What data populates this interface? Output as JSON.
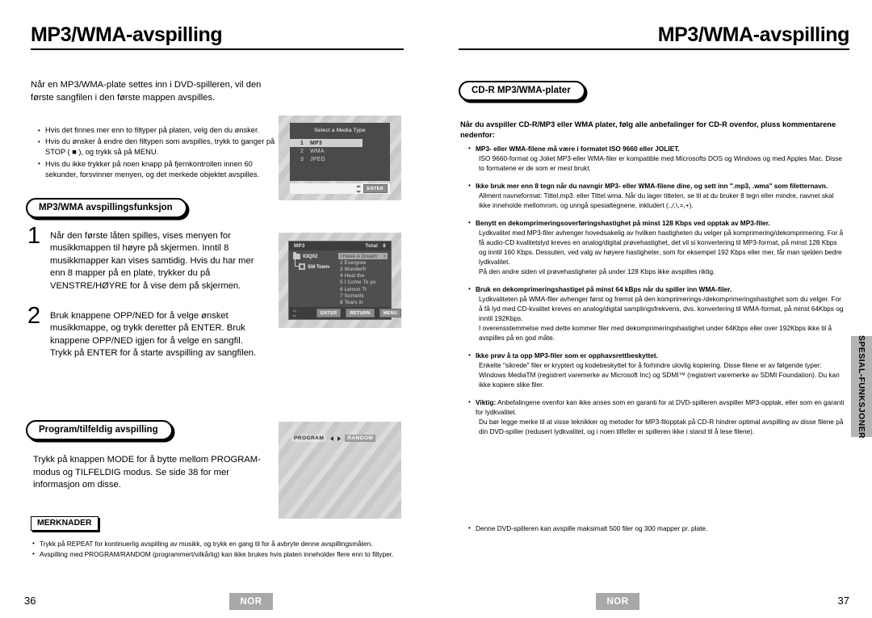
{
  "left_page": {
    "title": "MP3/WMA-avspilling",
    "intro": "Når en MP3/WMA-plate settes inn i DVD-spilleren, vil den første sangfilen i den første mappen avspilles.",
    "intro_bullets": [
      "Hvis det finnes mer enn to filtyper på platen, velg den du ønsker.",
      "Hvis du ønsker å endre den filtypen som avspilles, trykk to ganger på STOP ( ■ ), og trykk så på MENU.",
      "Hvis du ikke trykker på noen knapp på fjernkontrollen innen 60 sekunder, forsvinner menyen, og det merkede objektet avspilles."
    ],
    "section1_heading": "MP3/WMA avspillingsfunksjon",
    "steps": [
      {
        "num": "1",
        "text": "Når den første låten spilles, vises menyen for musikkmappen til høyre på skjermen. Inntil 8 musikkmapper kan vises samtidig. Hvis du har mer enn 8 mapper på en plate, trykker du på VENSTRE/HØYRE for å vise dem på skjermen."
      },
      {
        "num": "2",
        "text": "Bruk knappene OPP/NED for å velge ønsket musikkmappe, og trykk deretter på ENTER. Bruk knappene OPP/NED igjen for å velge en sangfil. Trykk på ENTER for å starte avspilling av sangfilen."
      }
    ],
    "section2_heading": "Program/tilfeldig avspilling",
    "section2_text": "Trykk på knappen MODE for å bytte mellom PROGRAM-modus og TILFELDIG modus. Se side 38 for mer informasjon om disse.",
    "notes_tag": "MERKNADER",
    "notes": [
      "Trykk på REPEAT for kontinuerlig avspilling av musikk, og trykk en gang til for å avbryte denne avspillingsmåten.",
      "Avspilling med PROGRAM/RANDOM (programmert/vilkårlig) kan ikke brukes hvis platen inneholder flere enn to filtyper."
    ],
    "page_number": "36",
    "language_badge": "NOR"
  },
  "osd_media_type": {
    "caption": "Select a Media Type",
    "options": [
      {
        "index": "1",
        "label": "MP3",
        "selected": true
      },
      {
        "index": "2",
        "label": "WMA",
        "selected": false
      },
      {
        "index": "3",
        "label": "JPEG",
        "selected": false
      }
    ],
    "enter_button": "ENTER"
  },
  "osd_mp3_browser": {
    "mode_label": "MP3",
    "total_label": "Total",
    "total_value": "8",
    "folder": "03Q02",
    "file": "SM Town-",
    "tracks": [
      {
        "index": "1",
        "title": "I Have A Dream",
        "selected": true
      },
      {
        "index": "2",
        "title": "Evergree",
        "selected": false
      },
      {
        "index": "3",
        "title": "Wonderfr",
        "selected": false
      },
      {
        "index": "4",
        "title": "Heal the",
        "selected": false
      },
      {
        "index": "5",
        "title": "I Come To yo",
        "selected": false
      },
      {
        "index": "6",
        "title": "Lemon Tr",
        "selected": false
      },
      {
        "index": "7",
        "title": "Somethi",
        "selected": false
      },
      {
        "index": "8",
        "title": "Tears in",
        "selected": false
      }
    ],
    "buttons": [
      "ENTER",
      "RETURN",
      "MENU"
    ]
  },
  "osd_program_random": {
    "program_label": "PROGRAM",
    "random_label": "RANDOM"
  },
  "right_page": {
    "title": "MP3/WMA-avspilling",
    "heading": "CD-R MP3/WMA-plater",
    "intro": "Når du avspiller CD-R/MP3 eller WMA plater, følg alle anbefalinger for CD-R ovenfor, pluss kommentarene nedenfor:",
    "items": [
      {
        "bold": "MP3- eller WMA-filene må være i formatet ISO 9660 eller JOLIET.",
        "body": "ISO 9660-format og Joliet MP3-eller WMA-filer er kompatible med Microsofts DOS og Windows og med Apples Mac. Disse to formatene er de som er mest brukt."
      },
      {
        "bold": "Ikke bruk mer enn 8 tegn når du navngir MP3- eller WMA-filene dine, og sett inn \".mp3, .wma\" som filetternavn.",
        "body": "Allment navneformat: Tittel.mp3. eller Tittel.wma. Når du lager tittelen, se til at du bruker 8 tegn eller mindre, navnet skal ikke inneholde mellomrom, og unngå spesialtegnene, inkludert (.,/,\\,=,+)."
      },
      {
        "bold": "Benytt en dekomprimeringsoverføringshastighet på minst 128 Kbps ved opptak av MP3-filer.",
        "body": "Lydkvalitet med MP3-filer avhenger hovedsakelig av hvilken hastigheten du velger på komprimering/dekomprimering. For å få audio-CD kvalitetslyd kreves en analog/digital prøvehastighet, det vil si konvertering til MP3-format, på minst 128 Kbps og inntil 160 Kbps. Dessuten, ved valg av høyere hastigheter, som for eksempel 192 Kbps eller mer, får man sjelden bedre lydkvalitet.",
        "body2": "På den andre siden vil prøvehastigheter på under 128 Kbps ikke avspilles riktig."
      },
      {
        "bold": "Bruk en dekomprimeringshastiget på minst 64 kBps når du spiller inn WMA-filer.",
        "body": "Lydkvaliteten på WMA-filer avhenger først og fremst på den komprimerings-/dekomprimeringshastighet som du velger. For å få lyd med CD-kvalitet kreves en analog/digital samplingsfrekvens, dvs. konvertering til WMA-format, på minst 64Kbps og inntil 192Kbps.",
        "body2": "I overensstemmelse med dette kommer filer med dekomprimeringshastighet under 64Kbps eller over 192Kbps ikke til å avspilles på en god måte."
      },
      {
        "bold": "Ikke prøv å ta opp MP3-filer som er opphavsrettbeskyttet.",
        "body": "Enkelte \"sikrede\" filer er kryptert og kodebeskyttet for å forhindre ulovlig kopiering. Disse filene er av følgende typer: Windows MediaTM (registrert varemerke av Microsoft Inc) og SDMI™ (registrert varemerke av SDMI Foundation). Du kan ikke kopiere slike filer."
      },
      {
        "bold": "Viktig:",
        "bold_inline_rest": " Anbefalingene ovenfor kan ikke anses som en garanti for at DVD-spilleren avspiller MP3-opptak, eller som en garanti for lydkvalitet.",
        "body": "Du bør legge merke til at visse teknikker og metoder for MP3-filopptak på CD-R hindrer optimal avspilling av disse filene på din DVD-spiller (redusert lydkvalitet, og i noen tilfeller er spilleren ikke i stand til å lese filene)."
      }
    ],
    "final_note": "Denne DVD-spilleren kan avspille maksimalt 500 filer og 300 mapper pr. plate.",
    "side_tab": "SPESIAL-FUNKSJONER",
    "page_number": "37",
    "language_badge": "NOR"
  }
}
